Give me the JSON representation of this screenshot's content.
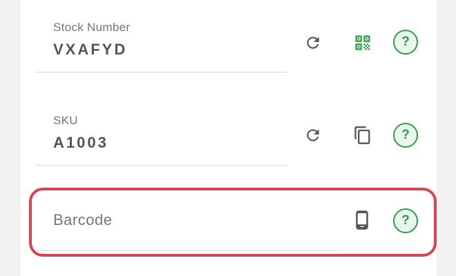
{
  "fields": {
    "stock_number": {
      "label": "Stock Number",
      "value": "VXAFYD"
    },
    "sku": {
      "label": "SKU",
      "value": "A1003"
    },
    "barcode": {
      "label": "Barcode"
    }
  },
  "help_symbol": "?",
  "icons": {
    "refresh": "refresh-icon",
    "qr": "qr-code-icon",
    "copy": "copy-icon",
    "phone": "mobile-phone-icon",
    "help": "help-icon"
  },
  "colors": {
    "accent_green": "#2e9e48",
    "highlight_red": "#d6444f",
    "icon_gray": "#555555"
  }
}
